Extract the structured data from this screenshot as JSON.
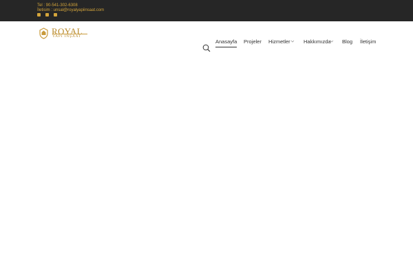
{
  "topbar": {
    "phone": "Tel : 90-541-302-6308",
    "email": "İletisim : unsal@royalyapiinsaat.com",
    "socials": [
      "facebook-icon",
      "twitter-icon",
      "linkedin-icon"
    ]
  },
  "logo": {
    "title": "ROYAL",
    "subtitle": "YAPI İNŞAAT"
  },
  "nav": {
    "items": [
      {
        "label": "Anasayfa",
        "active": true
      },
      {
        "label": "Projeler"
      },
      {
        "label": "Hizmetler",
        "has_dropdown": true
      },
      {
        "label": "Hakkımızda",
        "has_dropdown": true
      },
      {
        "label": "Blog"
      },
      {
        "label": "İletişim"
      }
    ]
  },
  "colors": {
    "topbar_bg": "#262626",
    "accent_gold": "#d4a53b",
    "logo_gold": "#b8892a",
    "nav_text": "#333333",
    "page_bg": "#ffffff"
  },
  "icons": {
    "search": "search-icon",
    "dropdown": "chevron-down-icon"
  }
}
